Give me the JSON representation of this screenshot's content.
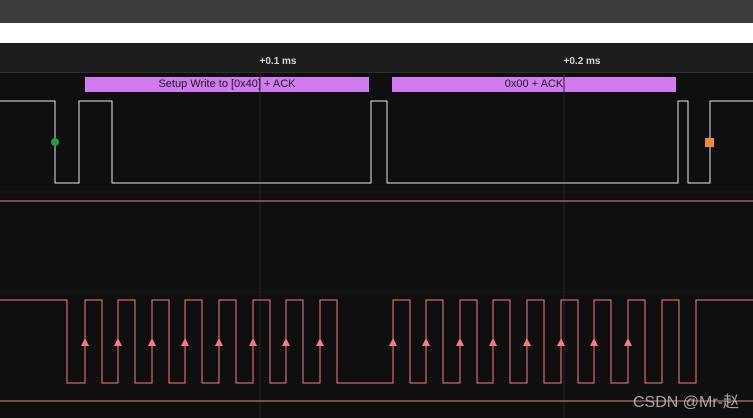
{
  "ruler": {
    "ticks": [
      "+0.1 ms",
      "+0.2 ms"
    ]
  },
  "decoder": {
    "frames": [
      "Setup Write to [0x40] + ACK",
      "0x00 + ACK"
    ]
  },
  "colors": {
    "sda_trace": "#e8e8e8",
    "scl_trace": "#ff7a7a",
    "decode_bubble": "#d27af0",
    "start_marker": "#1e9e4a",
    "stop_marker": "#f08a3c"
  },
  "watermark": "CSDN @Mr-赵"
}
